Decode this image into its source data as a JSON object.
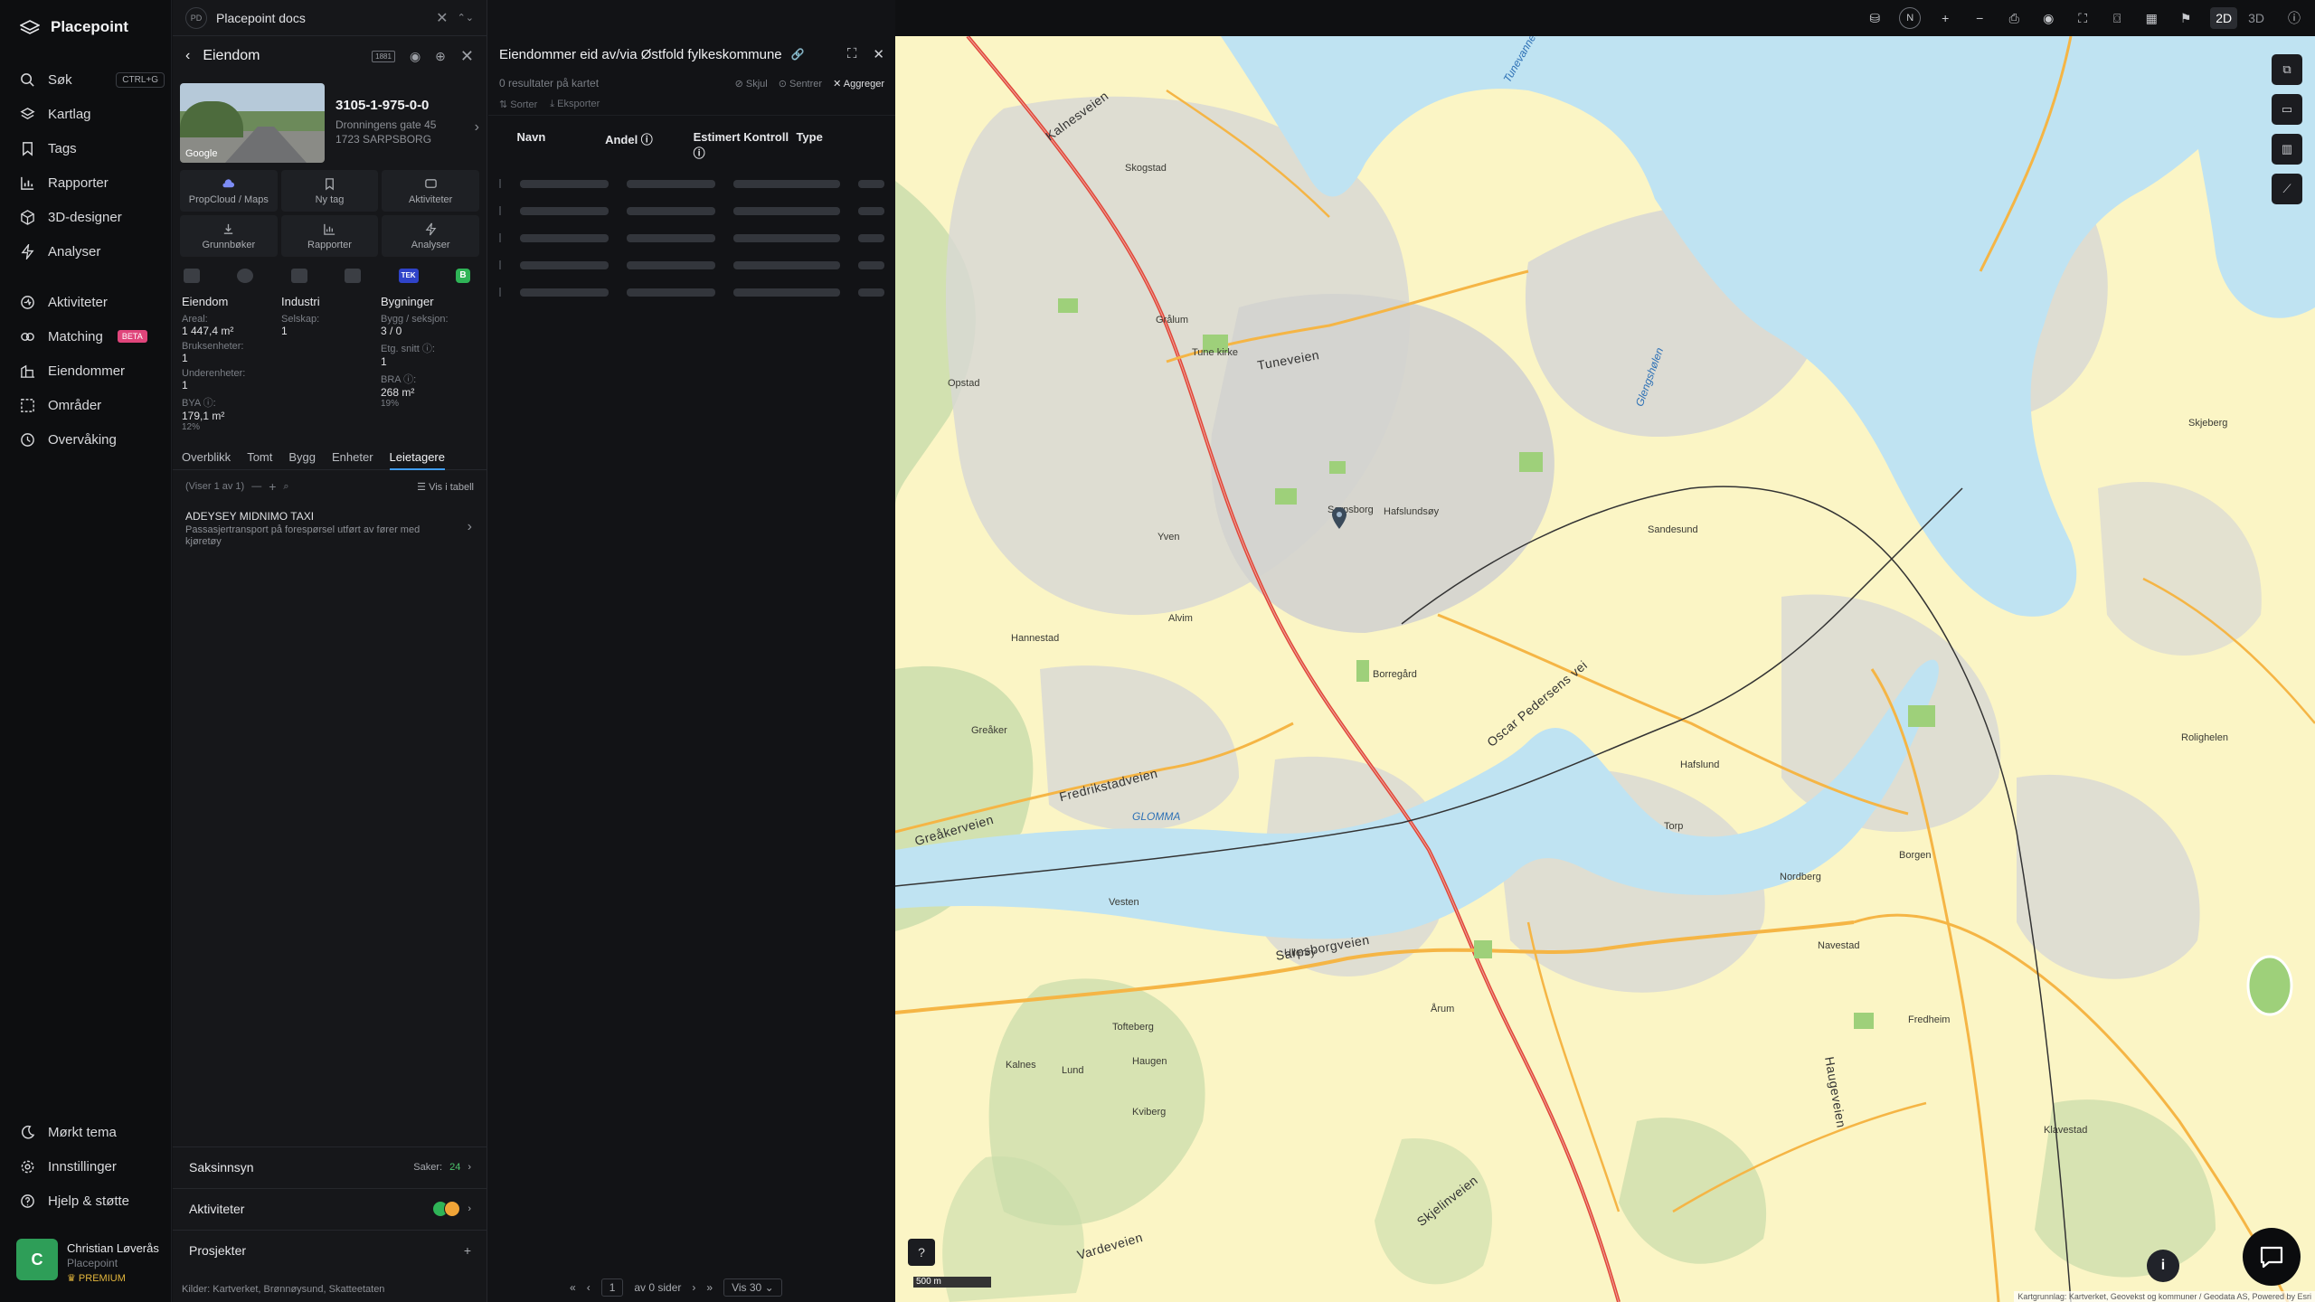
{
  "app": {
    "name": "Placepoint"
  },
  "nav": {
    "items": [
      {
        "label": "Søk",
        "icon": "search-icon",
        "shortcut": "CTRL+G"
      },
      {
        "label": "Kartlag",
        "icon": "layers-icon"
      },
      {
        "label": "Tags",
        "icon": "bookmark-icon"
      },
      {
        "label": "Rapporter",
        "icon": "chart-icon"
      },
      {
        "label": "3D-designer",
        "icon": "cube-icon"
      },
      {
        "label": "Analyser",
        "icon": "bolt-icon"
      },
      {
        "label": "Aktiviteter",
        "icon": "activity-icon"
      },
      {
        "label": "Matching",
        "icon": "matching-icon",
        "badge": "BETA"
      },
      {
        "label": "Eiendommer",
        "icon": "buildings-icon"
      },
      {
        "label": "Områder",
        "icon": "area-icon"
      },
      {
        "label": "Overvåking",
        "icon": "monitor-icon"
      }
    ],
    "bottom": [
      {
        "label": "Mørkt tema",
        "icon": "moon-icon"
      },
      {
        "label": "Innstillinger",
        "icon": "gear-icon"
      },
      {
        "label": "Hjelp & støtte",
        "icon": "help-icon"
      }
    ],
    "user": {
      "initial": "C",
      "name": "Christian Løverås",
      "org": "Placepoint",
      "plan": "PREMIUM"
    }
  },
  "panel": {
    "workspace_badge": "PD",
    "workspace_title": "Placepoint docs",
    "header_title": "Eiendom",
    "header_tag": "1881",
    "property": {
      "id": "3105-1-975-0-0",
      "street": "Dronningens gate 45",
      "city": "1723 SARPSBORG",
      "photo_credit": "Google"
    },
    "tiles": [
      "PropCloud / Maps",
      "Ny tag",
      "Aktiviteter",
      "Grunnbøker",
      "Rapporter",
      "Analyser"
    ],
    "badges": {
      "tek": "TEK",
      "b": "B"
    },
    "facts": {
      "col1": {
        "title": "Eiendom",
        "rows": [
          {
            "label": "Areal:",
            "value": "1 447,4 m²"
          },
          {
            "label": "Bruksenheter:",
            "value": "1"
          },
          {
            "label": "Underenheter:",
            "value": "1"
          },
          {
            "label": "BYA ⓘ:",
            "value": "179,1 m²",
            "pct": "12%"
          }
        ]
      },
      "col2": {
        "title": "Industri",
        "rows": [
          {
            "label": "Selskap:",
            "value": "1"
          }
        ]
      },
      "col3": {
        "title": "Bygninger",
        "rows": [
          {
            "label": "Bygg / seksjon:",
            "value": "3 / 0"
          },
          {
            "label": "Etg. snitt ⓘ:",
            "value": "1"
          },
          {
            "label": "BRA ⓘ:",
            "value": "268 m²",
            "pct": "19%"
          }
        ]
      }
    },
    "tabs": [
      "Overblikk",
      "Tomt",
      "Bygg",
      "Enheter",
      "Leietagere"
    ],
    "active_tab": "Leietagere",
    "list_status": "(Viser 1 av 1)",
    "view_table": "Vis i tabell",
    "tenant": {
      "name": "ADEYSEY MIDNIMO TAXI",
      "desc": "Passasjertransport på forespørsel utført av fører med kjøretøy"
    },
    "sections": {
      "saksinnsyn": {
        "label": "Saksinnsyn",
        "count_label": "Saker:",
        "count": "24"
      },
      "aktiviteter": {
        "label": "Aktiviteter"
      },
      "prosjekter": {
        "label": "Prosjekter"
      }
    },
    "sources": {
      "label": "Kilder:",
      "items": [
        "Kartverket,",
        "Brønnøysund,",
        "Skatteetaten"
      ]
    }
  },
  "results": {
    "title": "Eiendommer eid av/via Østfold fylkeskommune",
    "subtitle": "0 resultater på kartet",
    "actions": {
      "hide": "Skjul",
      "center": "Sentrer",
      "aggregate": "Aggreger"
    },
    "tools": {
      "sort": "Sorter",
      "export": "Eksporter"
    },
    "columns": [
      "Navn",
      "Andel ⓘ",
      "Estimert Kontroll ⓘ",
      "Type"
    ],
    "pager": {
      "page": "1",
      "of": "av 0 sider",
      "per_page": "Vis 30"
    }
  },
  "toolbar": {
    "north": "N",
    "mode_2d": "2D",
    "mode_3d": "3D"
  },
  "map": {
    "places": [
      "Hafslundsøy",
      "Sarpsborg",
      "Tune kirke",
      "Grålum",
      "Alvim",
      "Yven",
      "Hannestad",
      "Greåker",
      "Vesten",
      "Ullerøy",
      "Tofteberg",
      "Haugen",
      "Kviberg",
      "Årum",
      "Borregård",
      "Hafslund",
      "Borgen",
      "Navestad",
      "Kalnes",
      "Sandesund",
      "Torp",
      "Nordberg",
      "Fredheim",
      "Klavestad",
      "Lund",
      "Rolighelen",
      "Skjeberg",
      "Opstad",
      "Skogstad"
    ],
    "roads": [
      "Fredrikstadveien",
      "Sarpsborgveien",
      "Tuneveien",
      "Greåkerveien",
      "Skjelinveien",
      "Haugeveien",
      "Oscar Pedersens vei",
      "Vardeveien",
      "Kalnesveien"
    ],
    "waters": [
      "GLOMMA",
      "Tunevannet",
      "Glengshølen"
    ],
    "scale": "500 m",
    "attribution": "Kartgrunnlag: Kartverket, Geovekst og kommuner / Geodata AS, Powered by Esri",
    "colors": {
      "land": "#fbf5c5",
      "water": "#bfe3f2",
      "urban": "#d8d8d4",
      "forest": "#c8dcaa",
      "road_main": "#e0483a",
      "road_secondary": "#f5b545"
    }
  }
}
